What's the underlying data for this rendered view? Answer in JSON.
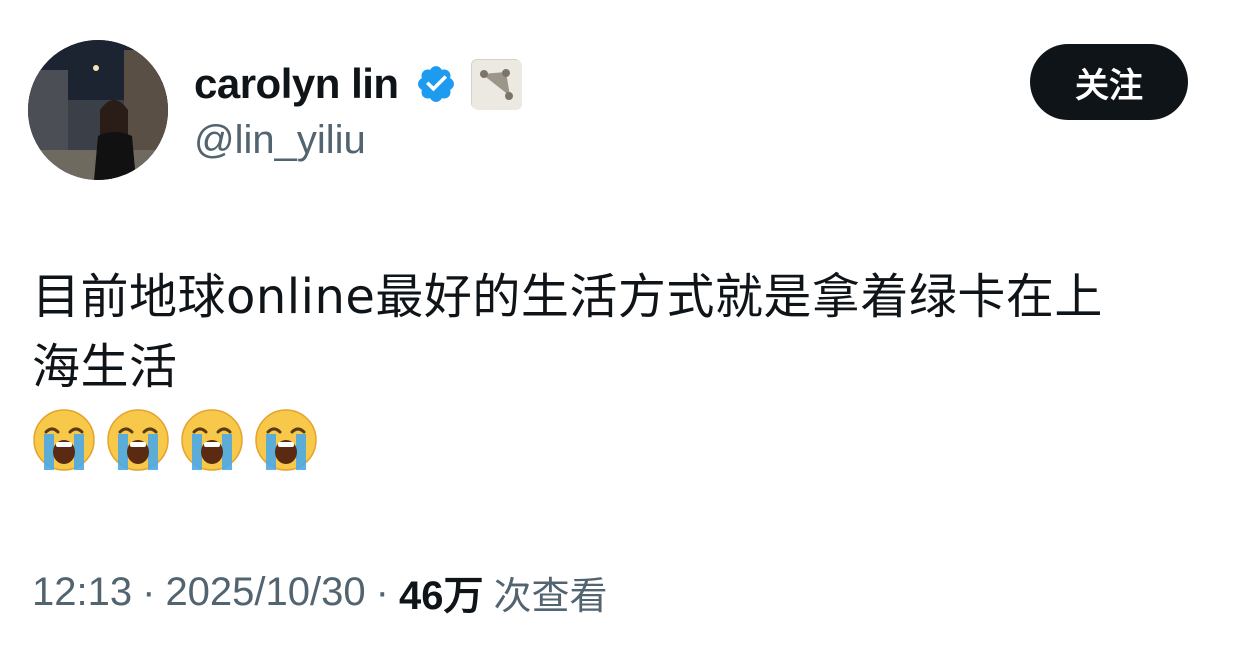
{
  "author": {
    "display_name": "carolyn lin",
    "handle": "@lin_yiliu",
    "verified": true,
    "verified_color": "#1d9bf0"
  },
  "follow_button": {
    "label": "关注",
    "background": "#0f1419",
    "text_color": "#ffffff"
  },
  "tweet": {
    "text_lines": [
      "目前地球online最好的生活方式就是拿着绿卡在上",
      "海生活"
    ],
    "emojis": [
      "loudly-crying-face",
      "loudly-crying-face",
      "loudly-crying-face",
      "loudly-crying-face"
    ]
  },
  "meta": {
    "time": "12:13",
    "separator": "·",
    "date": "2025/10/30",
    "views_count": "46万",
    "views_label": "次查看"
  }
}
